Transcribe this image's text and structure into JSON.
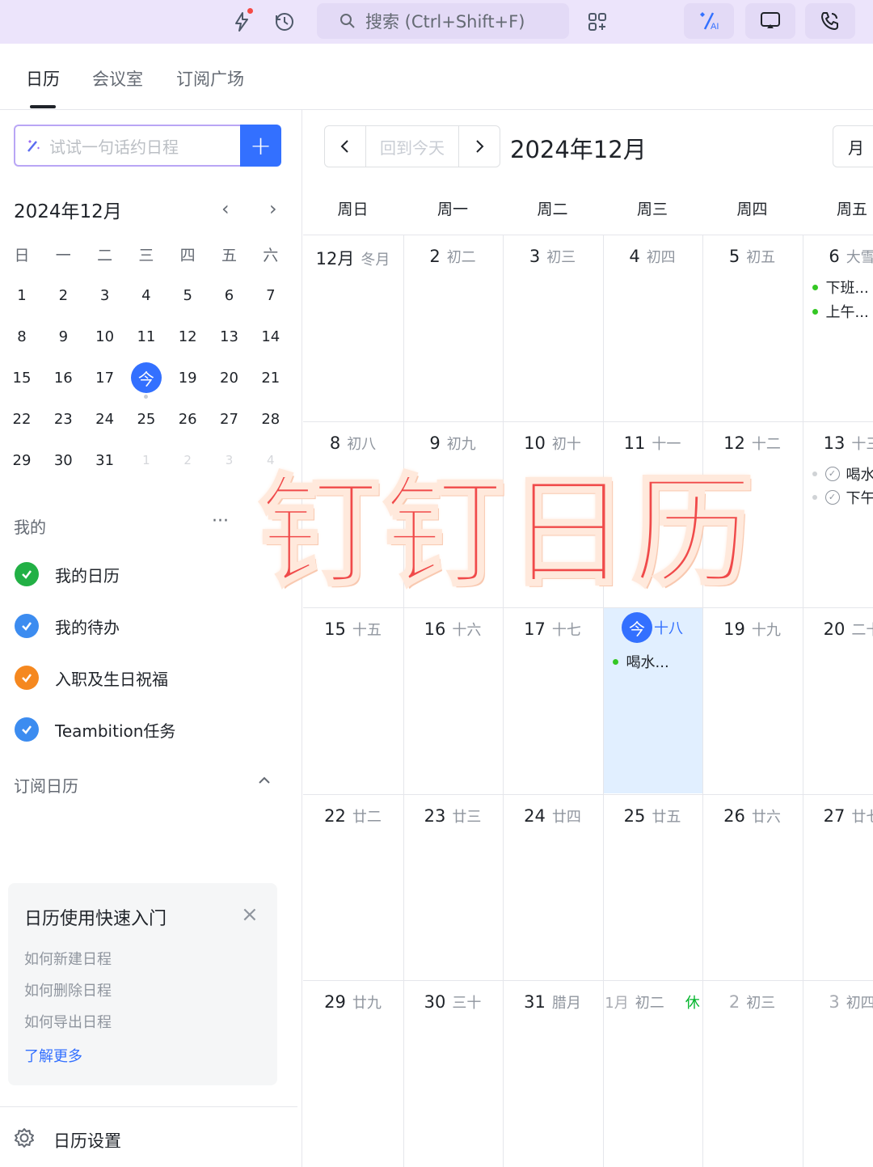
{
  "topbar": {
    "search_placeholder": "搜索 (Ctrl+Shift+F)"
  },
  "tabs": [
    {
      "label": "日历"
    },
    {
      "label": "会议室"
    },
    {
      "label": "订阅广场"
    }
  ],
  "sidebar": {
    "quick_input_placeholder": "试试一句话约日程",
    "add_label": "+",
    "mini_calendar": {
      "title": "2024年12月",
      "weekdays": [
        "日",
        "一",
        "二",
        "三",
        "四",
        "五",
        "六"
      ],
      "weeks": [
        [
          "1",
          "2",
          "3",
          "4",
          "5",
          "6",
          "7"
        ],
        [
          "8",
          "9",
          "10",
          "11",
          "12",
          "13",
          "14"
        ],
        [
          "15",
          "16",
          "17",
          "今",
          "19",
          "20",
          "21"
        ],
        [
          "22",
          "23",
          "24",
          "25",
          "26",
          "27",
          "28"
        ],
        [
          "29",
          "30",
          "31",
          "1",
          "2",
          "3",
          "4"
        ]
      ]
    },
    "mine_section": "我的",
    "more_label": "···",
    "calendars": [
      {
        "label": "我的日历",
        "color": "#22b045"
      },
      {
        "label": "我的待办",
        "color": "#3c8cf0"
      },
      {
        "label": "入职及生日祝福",
        "color": "#f5881f"
      },
      {
        "label": "Teambition任务",
        "color": "#3c8cf0"
      }
    ],
    "subscribed_section": "订阅日历",
    "guide": {
      "title": "日历使用快速入门",
      "close": "×",
      "links": [
        "如何新建日程",
        "如何删除日程",
        "如何导出日程"
      ],
      "more": "了解更多"
    },
    "settings_label": "日历设置"
  },
  "main": {
    "today_label": "回到今天",
    "month_title": "2024年12月",
    "view_label": "月",
    "weekdays": [
      "周日",
      "周一",
      "周二",
      "周三",
      "周四",
      "周五"
    ],
    "weeks": [
      [
        {
          "day": "12月",
          "lunar": "冬月"
        },
        {
          "day": "2",
          "lunar": "初二"
        },
        {
          "day": "3",
          "lunar": "初三"
        },
        {
          "day": "4",
          "lunar": "初四"
        },
        {
          "day": "5",
          "lunar": "初五"
        },
        {
          "day": "6",
          "lunar": "大雪",
          "events": [
            "下班...",
            "上午..."
          ]
        }
      ],
      [
        {
          "day": "8",
          "lunar": "初八"
        },
        {
          "day": "9",
          "lunar": "初九"
        },
        {
          "day": "10",
          "lunar": "初十"
        },
        {
          "day": "11",
          "lunar": "十一"
        },
        {
          "day": "12",
          "lunar": "十二"
        },
        {
          "day": "13",
          "lunar": "十三",
          "todos": [
            "喝水",
            "下午"
          ]
        }
      ],
      [
        {
          "day": "15",
          "lunar": "十五"
        },
        {
          "day": "16",
          "lunar": "十六"
        },
        {
          "day": "17",
          "lunar": "十七"
        },
        {
          "day": "今",
          "lunar": "十八",
          "today": true,
          "events": [
            "喝水..."
          ]
        },
        {
          "day": "19",
          "lunar": "十九"
        },
        {
          "day": "20",
          "lunar": "二十"
        }
      ],
      [
        {
          "day": "22",
          "lunar": "廿二"
        },
        {
          "day": "23",
          "lunar": "廿三"
        },
        {
          "day": "24",
          "lunar": "廿四"
        },
        {
          "day": "25",
          "lunar": "廿五"
        },
        {
          "day": "26",
          "lunar": "廿六"
        },
        {
          "day": "27",
          "lunar": "廿七"
        }
      ],
      [
        {
          "day": "29",
          "lunar": "廿九"
        },
        {
          "day": "30",
          "lunar": "三十"
        },
        {
          "day": "31",
          "lunar": "腊月"
        },
        {
          "day": "1月",
          "lunar": "初二",
          "dim": true,
          "holiday": "休"
        },
        {
          "day": "2",
          "lunar": "初三",
          "dim": true
        },
        {
          "day": "3",
          "lunar": "初四",
          "dim": true
        }
      ]
    ]
  },
  "overlay_text": "钉钉日历",
  "colors": {
    "accent": "#3370ff",
    "today_bg": "#e1efff",
    "topbar_bg": "#ece4fb",
    "event_dot": "#34c724",
    "holiday": "#00b42a",
    "overlay": "#f04a4a"
  }
}
